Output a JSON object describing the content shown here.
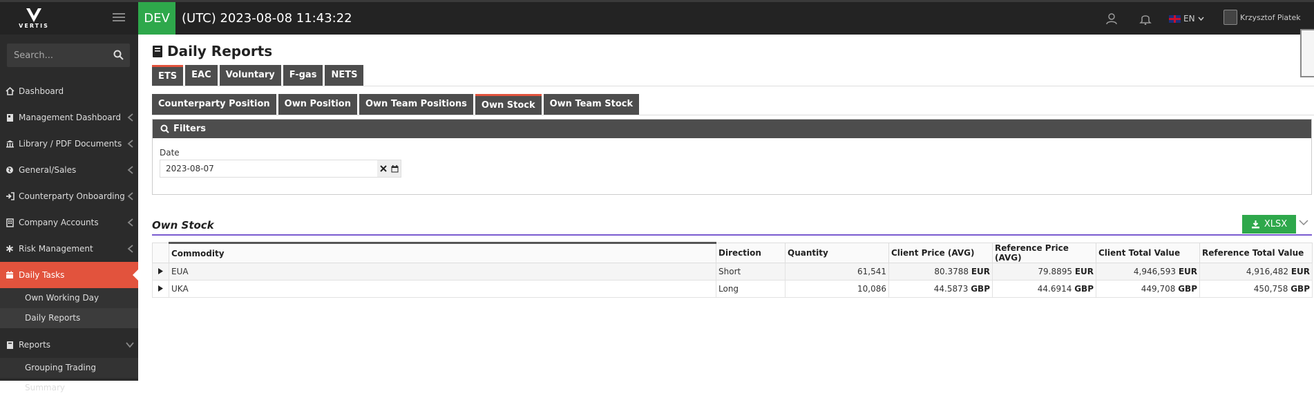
{
  "app": {
    "logo_text": "VERTIS",
    "env": "DEV",
    "clock": "(UTC) 2023-08-08 11:43:22"
  },
  "topbar": {
    "language": "EN",
    "user_name": "Krzysztof Piatek"
  },
  "sidebar": {
    "search_placeholder": "Search...",
    "items": [
      {
        "label": "Dashboard",
        "icon": "home-icon"
      },
      {
        "label": "Management Dashboard",
        "icon": "book-icon"
      },
      {
        "label": "Library / PDF Documents",
        "icon": "bank-icon"
      },
      {
        "label": "General/Sales",
        "icon": "globe-icon"
      },
      {
        "label": "Counterparty Onboarding",
        "icon": "sign-in-icon"
      },
      {
        "label": "Company Accounts",
        "icon": "building-icon"
      },
      {
        "label": "Risk Management",
        "icon": "asterisk-icon"
      },
      {
        "label": "Daily Tasks",
        "icon": "calendar-icon"
      }
    ],
    "daily_tasks_sub": [
      "Own Working Day",
      "Daily Reports"
    ],
    "reports": {
      "label": "Reports",
      "icon": "book-icon"
    },
    "reports_sub": [
      "Grouping Trading Summary"
    ]
  },
  "page": {
    "title": "Daily Reports",
    "market_tabs": [
      "ETS",
      "EAC",
      "Voluntary",
      "F-gas",
      "NETS"
    ],
    "report_tabs": [
      "Counterparty Position",
      "Own Position",
      "Own Team Positions",
      "Own Stock",
      "Own Team Stock"
    ],
    "filters": {
      "title": "Filters",
      "date_label": "Date",
      "date_value": "2023-08-07"
    },
    "section_title": "Own Stock",
    "export_label": "XLSX"
  },
  "table": {
    "columns": [
      "Commodity",
      "Direction",
      "Quantity",
      "Client Price (AVG)",
      "Reference Price (AVG)",
      "Client Total Value",
      "Reference Total Value"
    ],
    "rows": [
      {
        "commodity": "EUA",
        "direction": "Short",
        "quantity": "61,541",
        "client_price": "80.3788",
        "ref_price": "79.8895",
        "client_total": "4,946,593",
        "ref_total": "4,916,482",
        "currency": "EUR"
      },
      {
        "commodity": "UKA",
        "direction": "Long",
        "quantity": "10,086",
        "client_price": "44.5873",
        "ref_price": "44.6914",
        "client_total": "449,708",
        "ref_total": "450,758",
        "currency": "GBP"
      }
    ]
  },
  "colors": {
    "accent_red": "#e2533d",
    "green": "#2ea84b",
    "section_line": "#7a5bd0"
  }
}
